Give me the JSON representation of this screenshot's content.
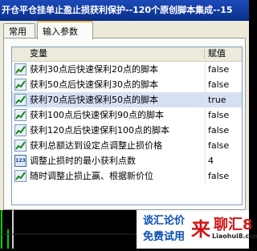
{
  "window": {
    "title": "开仓平仓挂单止盈止损获利保护--120个原创脚本集成--15"
  },
  "tabs": [
    {
      "label": "常用",
      "active": false
    },
    {
      "label": "输入参数",
      "active": true
    }
  ],
  "grid": {
    "header": {
      "variable": "变量",
      "value": "赋值"
    },
    "rows": [
      {
        "icon": "boolean-param-icon",
        "name": "获利30点后快速保利20点的脚本",
        "value": "false",
        "selected": false
      },
      {
        "icon": "boolean-param-icon",
        "name": "获利50点后快速保利30点的脚本",
        "value": "false",
        "selected": false
      },
      {
        "icon": "boolean-param-icon",
        "name": "获利70点后快速保利50点的脚本",
        "value": "true",
        "selected": true
      },
      {
        "icon": "boolean-param-icon",
        "name": "获利100点后快速保利90点的脚本",
        "value": "false",
        "selected": false
      },
      {
        "icon": "boolean-param-icon",
        "name": "获利120点后快速保利100点的脚本",
        "value": "false",
        "selected": false
      },
      {
        "icon": "boolean-param-icon",
        "name": "获利总额达到设定点调整止损价格",
        "value": "false",
        "selected": false
      },
      {
        "icon": "integer-param-icon",
        "name": "调整止损时的最小获利点数",
        "value": "4",
        "selected": false
      },
      {
        "icon": "boolean-param-icon",
        "name": "随时调整止损止赢、根据新价位",
        "value": "false",
        "selected": false
      }
    ]
  },
  "promo": {
    "line1": "谈汇论价",
    "line2": "免费试用",
    "lai": "来",
    "brand": "聊汇8",
    "url": "Liaohui8.com"
  },
  "colors": {
    "titlebar": "#0a2f8a",
    "selected_row": "#d6e0f5",
    "tab_highlight": "#f9b641",
    "promo_red": "#d01818",
    "promo_blue": "#0a4fb5"
  }
}
